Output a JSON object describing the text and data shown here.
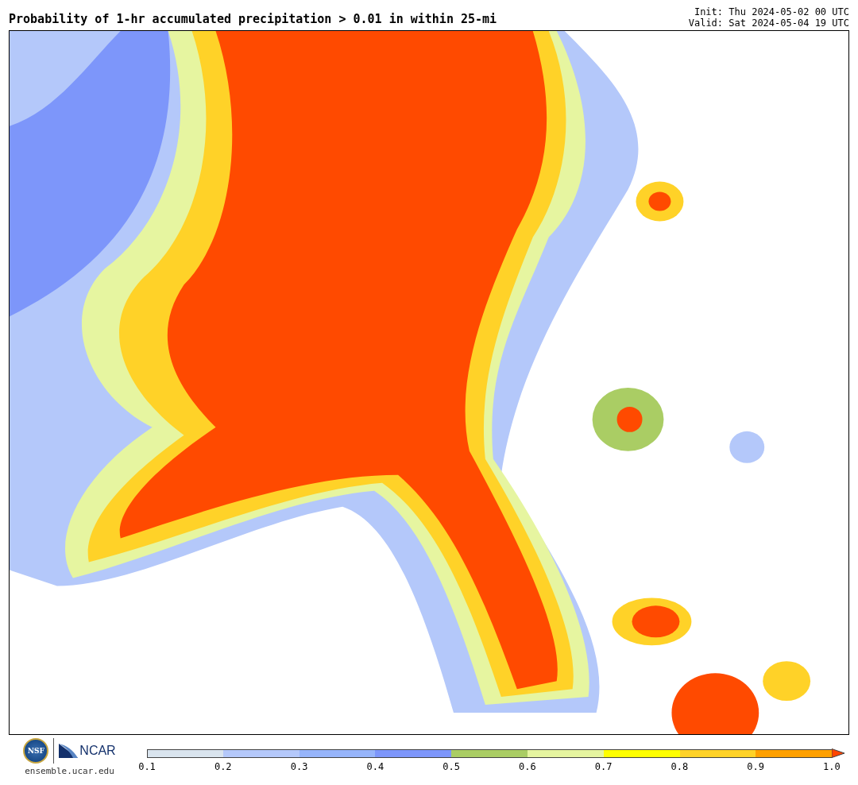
{
  "header": {
    "title": "Probability of 1-hr accumulated precipitation > 0.01 in within 25-mi",
    "init": "Init: Thu 2024-05-02 00 UTC",
    "valid": "Valid: Sat 2024-05-04 19 UTC"
  },
  "footer": {
    "nsf_logo": "NSF",
    "ncar_logo": "NCAR",
    "url": "ensemble.ucar.edu"
  },
  "colorbar": {
    "segments": [
      {
        "color": "#d9e4ee"
      },
      {
        "color": "#b4c8fa"
      },
      {
        "color": "#96b4fa"
      },
      {
        "color": "#7d96fa"
      },
      {
        "color": "#aacd64"
      },
      {
        "color": "#e6f5a0"
      },
      {
        "color": "#ffff00"
      },
      {
        "color": "#ffd228"
      },
      {
        "color": "#ffa000"
      },
      {
        "color": "#ff4500",
        "kind": "arrow"
      }
    ],
    "ticks": [
      "0.1",
      "0.2",
      "0.3",
      "0.4",
      "0.5",
      "0.6",
      "0.7",
      "0.8",
      "0.9",
      "1.0"
    ]
  }
}
